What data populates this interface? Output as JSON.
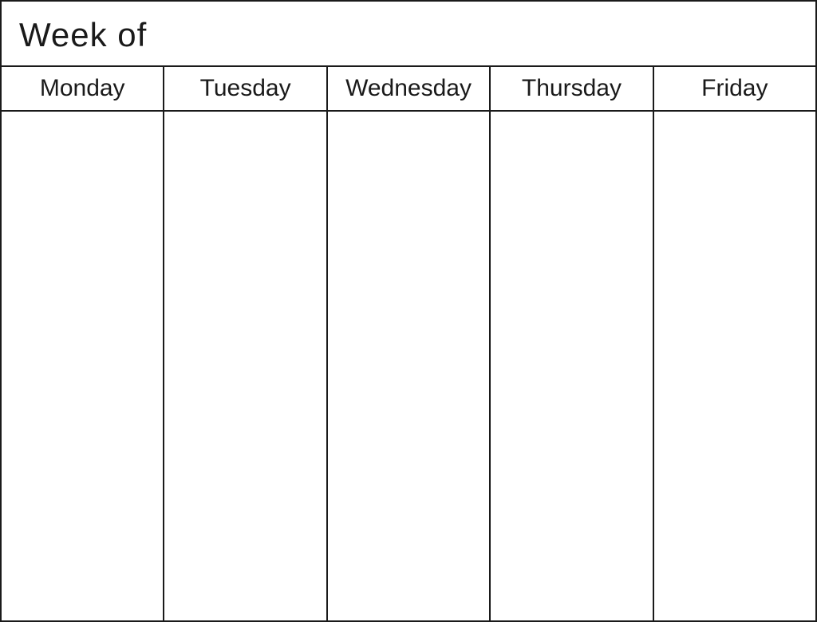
{
  "header": {
    "week_of_label": "Week of"
  },
  "calendar": {
    "days": [
      {
        "id": "monday",
        "label": "Monday"
      },
      {
        "id": "tuesday",
        "label": "Tuesday"
      },
      {
        "id": "wednesday",
        "label": "Wednesday"
      },
      {
        "id": "thursday",
        "label": "Thursday"
      },
      {
        "id": "friday",
        "label": "Friday"
      }
    ]
  },
  "colors": {
    "border": "#1a1a1a",
    "background": "#ffffff",
    "text": "#1a1a1a"
  }
}
